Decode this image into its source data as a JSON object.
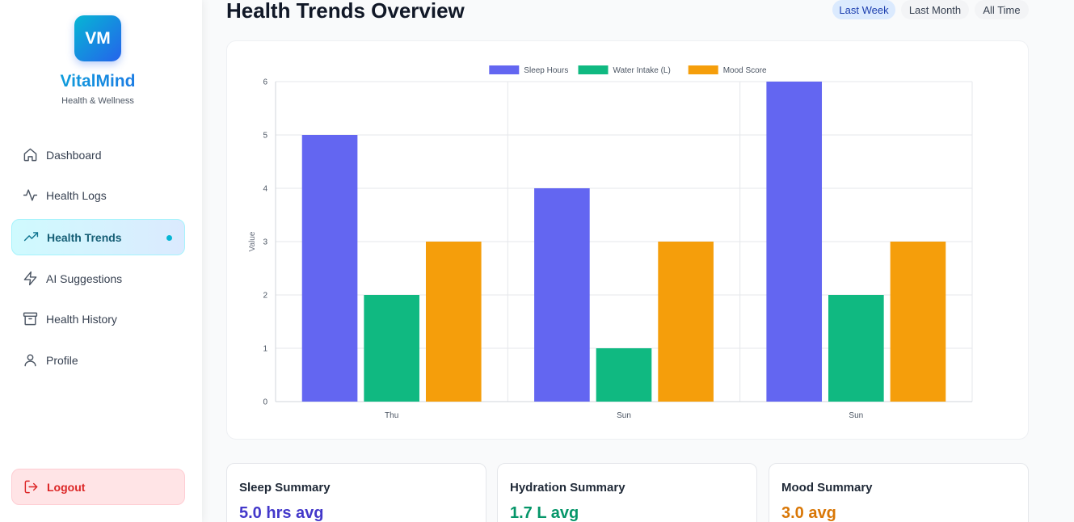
{
  "brand": {
    "logo_text": "VM",
    "name": "VitalMind",
    "tagline": "Health & Wellness"
  },
  "nav": [
    {
      "label": "Dashboard",
      "icon": "home-icon"
    },
    {
      "label": "Health Logs",
      "icon": "activity-icon"
    },
    {
      "label": "Health Trends",
      "icon": "trending-up-icon",
      "active": true
    },
    {
      "label": "AI Suggestions",
      "icon": "zap-icon"
    },
    {
      "label": "Health History",
      "icon": "archive-icon"
    },
    {
      "label": "Profile",
      "icon": "user-icon"
    }
  ],
  "logout": {
    "label": "Logout",
    "icon": "log-out-icon"
  },
  "header": {
    "title": "Health Trends Overview",
    "filters": [
      {
        "label": "Last Week",
        "active": true
      },
      {
        "label": "Last Month",
        "active": false
      },
      {
        "label": "All Time",
        "active": false
      }
    ]
  },
  "chart_data": {
    "type": "bar",
    "categories": [
      "Thu",
      "Sun",
      "Sun"
    ],
    "series": [
      {
        "name": "Sleep Hours",
        "values": [
          5,
          4,
          6
        ],
        "color": "#6366f1"
      },
      {
        "name": "Water Intake (L)",
        "values": [
          2,
          1,
          2
        ],
        "color": "#10b981"
      },
      {
        "name": "Mood Score",
        "values": [
          3,
          3,
          3
        ],
        "color": "#f59e0b"
      }
    ],
    "xlabel": "",
    "ylabel": "Value",
    "ylim": [
      0,
      6
    ],
    "yticks": [
      0,
      1,
      2,
      3,
      4,
      5,
      6
    ],
    "grid": true,
    "legend_position": "top"
  },
  "summaries": [
    {
      "title": "Sleep Summary",
      "value": "5.0 hrs avg",
      "color": "#4338ca"
    },
    {
      "title": "Hydration Summary",
      "value": "1.7 L avg",
      "color": "#059669"
    },
    {
      "title": "Mood Summary",
      "value": "3.0 avg",
      "color": "#d97706"
    }
  ]
}
